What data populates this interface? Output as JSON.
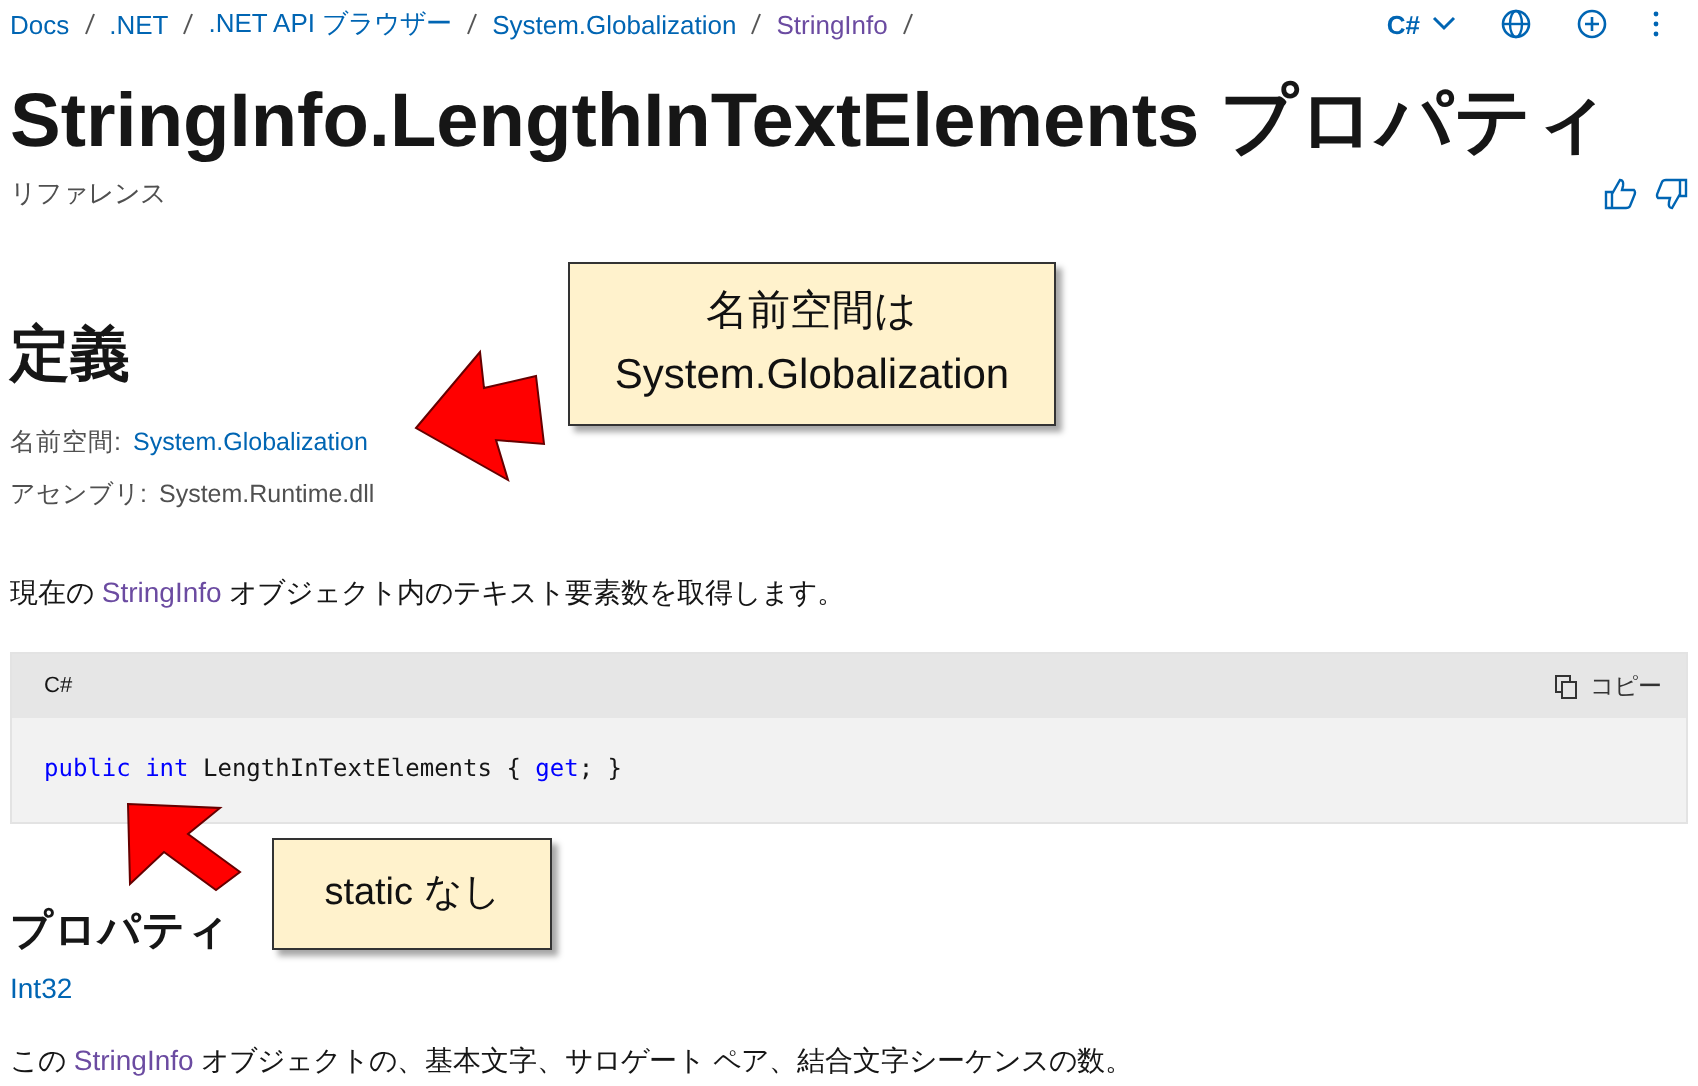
{
  "breadcrumb": [
    {
      "label": "Docs",
      "current": false
    },
    {
      "label": ".NET",
      "current": false
    },
    {
      "label": ".NET API ブラウザー",
      "current": false
    },
    {
      "label": "System.Globalization",
      "current": false
    },
    {
      "label": "StringInfo",
      "current": true
    }
  ],
  "header_tools": {
    "language": "C#"
  },
  "title": "StringInfo.LengthInTextElements プロパティ",
  "subtitle": "リファレンス",
  "definition": {
    "heading": "定義",
    "namespace_label": "名前空間:",
    "namespace": "System.Globalization",
    "assembly_label": "アセンブリ:",
    "assembly": "System.Runtime.dll"
  },
  "summary": {
    "before": "現在の",
    "link": "StringInfo",
    "after": "オブジェクト内のテキスト要素数を取得します。"
  },
  "code": {
    "language": "C#",
    "copy_label": "コピー",
    "tokens": [
      {
        "text": "public",
        "kind": "keyword"
      },
      {
        "text": " int",
        "kind": "keyword"
      },
      {
        "text": " LengthInTextElements { ",
        "kind": "plain"
      },
      {
        "text": "get",
        "kind": "keyword"
      },
      {
        "text": "; }",
        "kind": "plain"
      }
    ]
  },
  "property_value": {
    "heading": "プロパティ",
    "type": "Int32",
    "description_before": "この",
    "description_link": "StringInfo",
    "description_after": "オブジェクトの、基本文字、サロゲート ペア、結合文字シーケンスの数。"
  },
  "callouts": [
    {
      "lines": [
        "名前空間は",
        "System.Globalization"
      ]
    },
    {
      "lines": [
        "static なし"
      ]
    }
  ]
}
